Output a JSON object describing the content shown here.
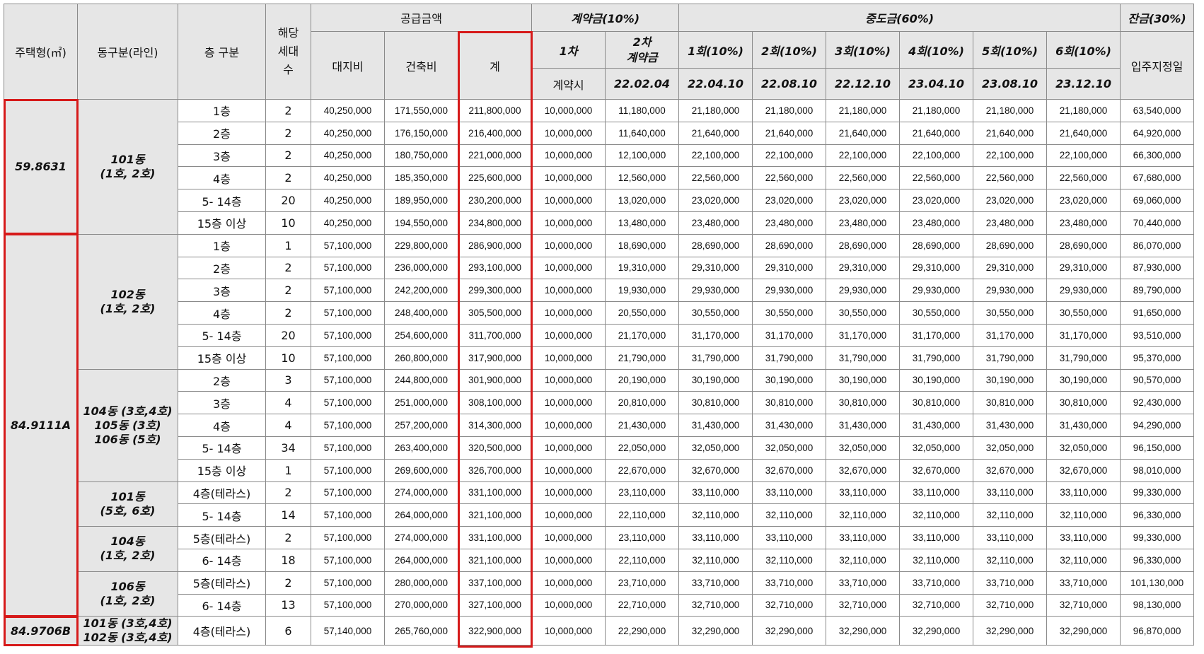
{
  "headers": {
    "type": "주택형(㎡)",
    "dong": "동구분(라인)",
    "floor": "층 구분",
    "count": "해당\n세대\n수",
    "supply": "공급금액",
    "land": "대지비",
    "building": "건축비",
    "total": "계",
    "contract": "계약금(10%)",
    "contract1": "1차",
    "contract1_when": "계약시",
    "contract2": "2차\n계약금",
    "contract2_when": "22.02.04",
    "middle": "중도금(60%)",
    "middle_rounds": [
      {
        "label": "1회(10%)",
        "date": "22.04.10"
      },
      {
        "label": "2회(10%)",
        "date": "22.08.10"
      },
      {
        "label": "3회(10%)",
        "date": "22.12.10"
      },
      {
        "label": "4회(10%)",
        "date": "23.04.10"
      },
      {
        "label": "5회(10%)",
        "date": "23.08.10"
      },
      {
        "label": "6회(10%)",
        "date": "23.12.10"
      }
    ],
    "balance": "잔금(30%)",
    "balance_when": "입주지정일"
  },
  "groups": [
    {
      "type": "59.8631",
      "dongs": [
        {
          "dong": "101동\n(1호, 2호)",
          "rows": [
            {
              "floor": "1층",
              "count": "2",
              "land": "40,250,000",
              "building": "171,550,000",
              "total": "211,800,000",
              "c1": "10,000,000",
              "c2": "11,180,000",
              "mid": "21,180,000",
              "bal": "63,540,000"
            },
            {
              "floor": "2층",
              "count": "2",
              "land": "40,250,000",
              "building": "176,150,000",
              "total": "216,400,000",
              "c1": "10,000,000",
              "c2": "11,640,000",
              "mid": "21,640,000",
              "bal": "64,920,000"
            },
            {
              "floor": "3층",
              "count": "2",
              "land": "40,250,000",
              "building": "180,750,000",
              "total": "221,000,000",
              "c1": "10,000,000",
              "c2": "12,100,000",
              "mid": "22,100,000",
              "bal": "66,300,000"
            },
            {
              "floor": "4층",
              "count": "2",
              "land": "40,250,000",
              "building": "185,350,000",
              "total": "225,600,000",
              "c1": "10,000,000",
              "c2": "12,560,000",
              "mid": "22,560,000",
              "bal": "67,680,000"
            },
            {
              "floor": "5- 14층",
              "count": "20",
              "land": "40,250,000",
              "building": "189,950,000",
              "total": "230,200,000",
              "c1": "10,000,000",
              "c2": "13,020,000",
              "mid": "23,020,000",
              "bal": "69,060,000"
            },
            {
              "floor": "15층 이상",
              "count": "10",
              "land": "40,250,000",
              "building": "194,550,000",
              "total": "234,800,000",
              "c1": "10,000,000",
              "c2": "13,480,000",
              "mid": "23,480,000",
              "bal": "70,440,000"
            }
          ]
        }
      ]
    },
    {
      "type": "84.9111A",
      "dongs": [
        {
          "dong": "102동\n(1호, 2호)",
          "rows": [
            {
              "floor": "1층",
              "count": "1",
              "land": "57,100,000",
              "building": "229,800,000",
              "total": "286,900,000",
              "c1": "10,000,000",
              "c2": "18,690,000",
              "mid": "28,690,000",
              "bal": "86,070,000"
            },
            {
              "floor": "2층",
              "count": "2",
              "land": "57,100,000",
              "building": "236,000,000",
              "total": "293,100,000",
              "c1": "10,000,000",
              "c2": "19,310,000",
              "mid": "29,310,000",
              "bal": "87,930,000"
            },
            {
              "floor": "3층",
              "count": "2",
              "land": "57,100,000",
              "building": "242,200,000",
              "total": "299,300,000",
              "c1": "10,000,000",
              "c2": "19,930,000",
              "mid": "29,930,000",
              "bal": "89,790,000"
            },
            {
              "floor": "4층",
              "count": "2",
              "land": "57,100,000",
              "building": "248,400,000",
              "total": "305,500,000",
              "c1": "10,000,000",
              "c2": "20,550,000",
              "mid": "30,550,000",
              "bal": "91,650,000"
            },
            {
              "floor": "5- 14층",
              "count": "20",
              "land": "57,100,000",
              "building": "254,600,000",
              "total": "311,700,000",
              "c1": "10,000,000",
              "c2": "21,170,000",
              "mid": "31,170,000",
              "bal": "93,510,000"
            },
            {
              "floor": "15층 이상",
              "count": "10",
              "land": "57,100,000",
              "building": "260,800,000",
              "total": "317,900,000",
              "c1": "10,000,000",
              "c2": "21,790,000",
              "mid": "31,790,000",
              "bal": "95,370,000"
            }
          ]
        },
        {
          "dong": "104동 (3호,4호)\n105동 (3호)\n106동 (5호)",
          "rows": [
            {
              "floor": "2층",
              "count": "3",
              "land": "57,100,000",
              "building": "244,800,000",
              "total": "301,900,000",
              "c1": "10,000,000",
              "c2": "20,190,000",
              "mid": "30,190,000",
              "bal": "90,570,000"
            },
            {
              "floor": "3층",
              "count": "4",
              "land": "57,100,000",
              "building": "251,000,000",
              "total": "308,100,000",
              "c1": "10,000,000",
              "c2": "20,810,000",
              "mid": "30,810,000",
              "bal": "92,430,000"
            },
            {
              "floor": "4층",
              "count": "4",
              "land": "57,100,000",
              "building": "257,200,000",
              "total": "314,300,000",
              "c1": "10,000,000",
              "c2": "21,430,000",
              "mid": "31,430,000",
              "bal": "94,290,000"
            },
            {
              "floor": "5- 14층",
              "count": "34",
              "land": "57,100,000",
              "building": "263,400,000",
              "total": "320,500,000",
              "c1": "10,000,000",
              "c2": "22,050,000",
              "mid": "32,050,000",
              "bal": "96,150,000"
            },
            {
              "floor": "15층 이상",
              "count": "1",
              "land": "57,100,000",
              "building": "269,600,000",
              "total": "326,700,000",
              "c1": "10,000,000",
              "c2": "22,670,000",
              "mid": "32,670,000",
              "bal": "98,010,000"
            }
          ]
        },
        {
          "dong": "101동\n(5호, 6호)",
          "rows": [
            {
              "floor": "4층(테라스)",
              "count": "2",
              "land": "57,100,000",
              "building": "274,000,000",
              "total": "331,100,000",
              "c1": "10,000,000",
              "c2": "23,110,000",
              "mid": "33,110,000",
              "bal": "99,330,000"
            },
            {
              "floor": "5- 14층",
              "count": "14",
              "land": "57,100,000",
              "building": "264,000,000",
              "total": "321,100,000",
              "c1": "10,000,000",
              "c2": "22,110,000",
              "mid": "32,110,000",
              "bal": "96,330,000"
            }
          ]
        },
        {
          "dong": "104동\n(1호, 2호)",
          "rows": [
            {
              "floor": "5층(테라스)",
              "count": "2",
              "land": "57,100,000",
              "building": "274,000,000",
              "total": "331,100,000",
              "c1": "10,000,000",
              "c2": "23,110,000",
              "mid": "33,110,000",
              "bal": "99,330,000"
            },
            {
              "floor": "6- 14층",
              "count": "18",
              "land": "57,100,000",
              "building": "264,000,000",
              "total": "321,100,000",
              "c1": "10,000,000",
              "c2": "22,110,000",
              "mid": "32,110,000",
              "bal": "96,330,000"
            }
          ]
        },
        {
          "dong": "106동\n(1호, 2호)",
          "rows": [
            {
              "floor": "5층(테라스)",
              "count": "2",
              "land": "57,100,000",
              "building": "280,000,000",
              "total": "337,100,000",
              "c1": "10,000,000",
              "c2": "23,710,000",
              "mid": "33,710,000",
              "bal": "101,130,000"
            },
            {
              "floor": "6- 14층",
              "count": "13",
              "land": "57,100,000",
              "building": "270,000,000",
              "total": "327,100,000",
              "c1": "10,000,000",
              "c2": "22,710,000",
              "mid": "32,710,000",
              "bal": "98,130,000"
            }
          ]
        }
      ]
    },
    {
      "type": "84.9706B",
      "dongs": [
        {
          "dong": "101동 (3호,4호)\n102동 (3호,4호)",
          "rows": [
            {
              "floor": "4층(테라스)",
              "count": "6",
              "land": "57,140,000",
              "building": "265,760,000",
              "total": "322,900,000",
              "c1": "10,000,000",
              "c2": "22,290,000",
              "mid": "32,290,000",
              "bal": "96,870,000"
            }
          ]
        }
      ]
    }
  ],
  "highlight_color": "#d61a1a"
}
